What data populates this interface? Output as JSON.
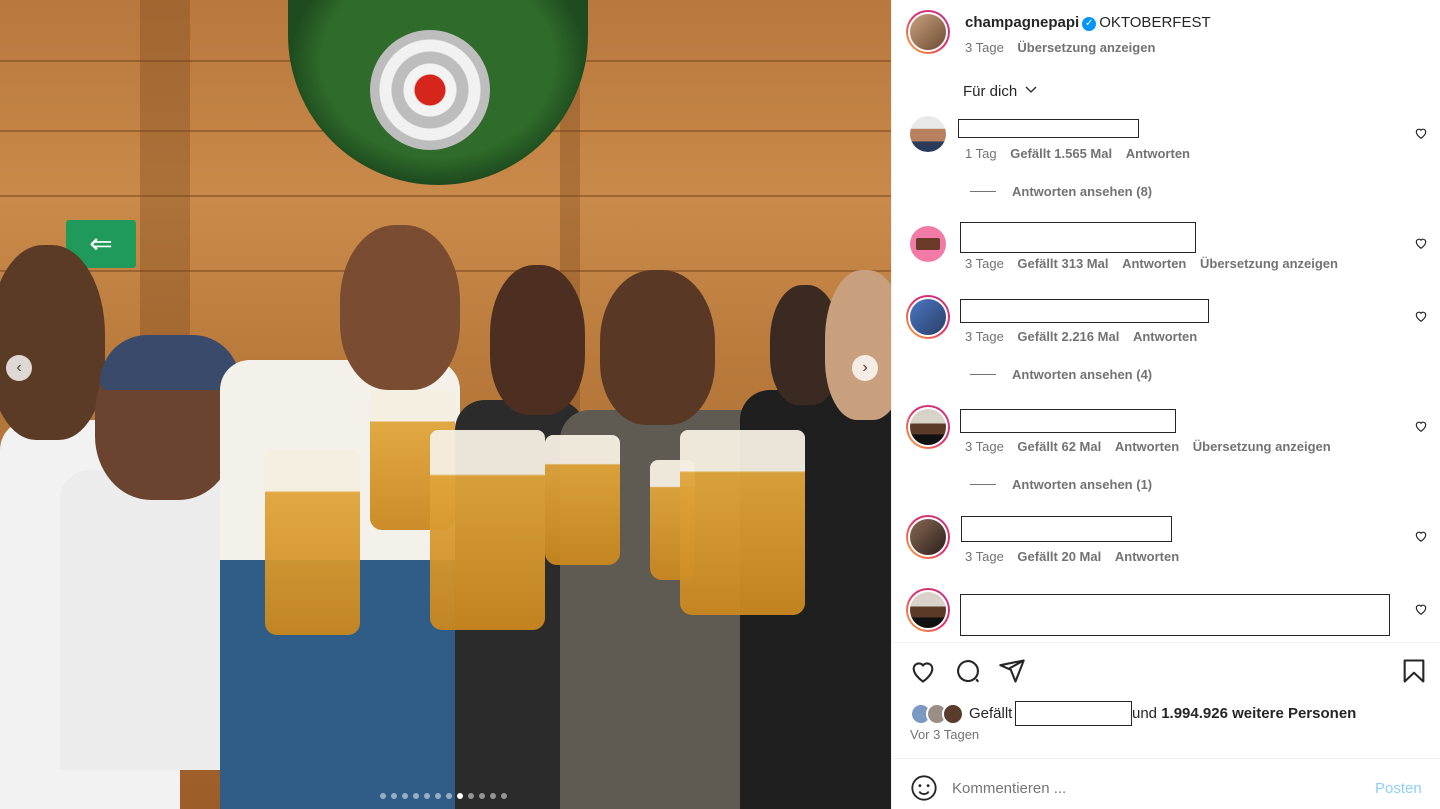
{
  "post": {
    "username": "champagnepapi",
    "caption": "OKTOBERFEST",
    "age": "3 Tage",
    "translate": "Übersetzung anzeigen"
  },
  "filter": {
    "label": "Für dich",
    "chevron_icon": "chevron-down-icon"
  },
  "comments": [
    {
      "age": "1 Tag",
      "likes": "Gefällt 1.565 Mal",
      "reply": "Antworten",
      "translate": "",
      "view_replies": "Antworten ansehen (8)"
    },
    {
      "age": "3 Tage",
      "likes": "Gefällt 313 Mal",
      "reply": "Antworten",
      "translate": "Übersetzung anzeigen",
      "view_replies": ""
    },
    {
      "age": "3 Tage",
      "likes": "Gefällt 2.216 Mal",
      "reply": "Antworten",
      "translate": "",
      "view_replies": "Antworten ansehen (4)"
    },
    {
      "age": "3 Tage",
      "likes": "Gefällt 62 Mal",
      "reply": "Antworten",
      "translate": "Übersetzung anzeigen",
      "view_replies": "Antworten ansehen (1)"
    },
    {
      "age": "3 Tage",
      "likes": "Gefällt 20 Mal",
      "reply": "Antworten",
      "translate": "",
      "view_replies": ""
    }
  ],
  "actions": {
    "like_icon": "heart-icon",
    "comment_icon": "comment-icon",
    "share_icon": "send-icon",
    "save_icon": "bookmark-icon"
  },
  "likes_summary": {
    "prefix": "Gefällt",
    "connector": "und",
    "others": "1.994.926 weitere Personen",
    "date": "Vor 3 Tagen"
  },
  "comment_input": {
    "placeholder": "Kommentieren ...",
    "post_label": "Posten",
    "emoji_icon": "emoji-icon"
  },
  "carousel": {
    "count": 12,
    "active_index": 7
  },
  "colors": {
    "link_blue": "#0095f6",
    "text": "#262626",
    "secondary": "#737373"
  }
}
